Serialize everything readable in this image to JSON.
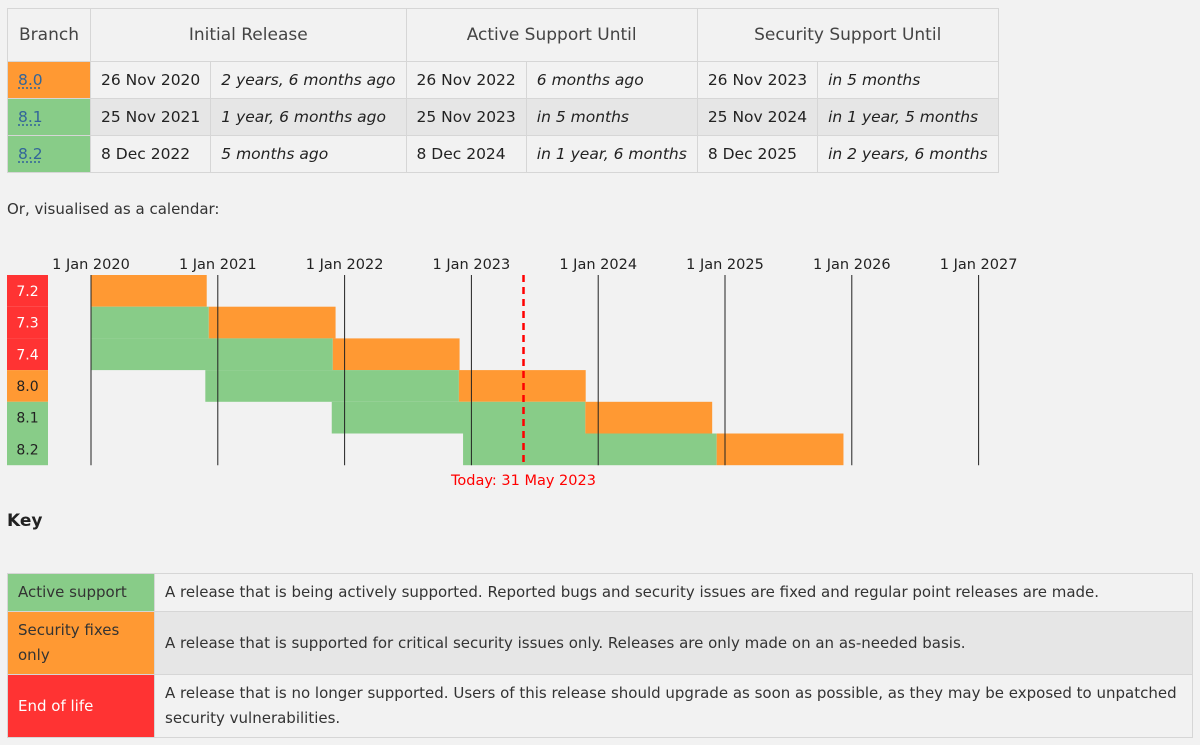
{
  "colors": {
    "active": "#88cc88",
    "security": "#ff9933",
    "eol": "#ff3333",
    "today": "#ff0000",
    "link": "#336699"
  },
  "table": {
    "headers": {
      "branch": "Branch",
      "initial_release": "Initial Release",
      "active_support": "Active Support Until",
      "security_support": "Security Support Until"
    },
    "rows": [
      {
        "branch": "8.0",
        "status": "security",
        "initial": "26 Nov 2020",
        "initial_rel": "2 years, 6 months ago",
        "active": "26 Nov 2022",
        "active_rel": "6 months ago",
        "security": "26 Nov 2023",
        "security_rel": "in 5 months"
      },
      {
        "branch": "8.1",
        "status": "stable",
        "initial": "25 Nov 2021",
        "initial_rel": "1 year, 6 months ago",
        "active": "25 Nov 2023",
        "active_rel": "in 5 months",
        "security": "25 Nov 2024",
        "security_rel": "in 1 year, 5 months"
      },
      {
        "branch": "8.2",
        "status": "stable",
        "initial": "8 Dec 2022",
        "initial_rel": "5 months ago",
        "active": "8 Dec 2024",
        "active_rel": "in 1 year, 6 months",
        "security": "8 Dec 2025",
        "security_rel": "in 2 years, 6 months"
      }
    ]
  },
  "intro_text": "Or, visualised as a calendar:",
  "chart_data": {
    "type": "gantt",
    "title": "",
    "x_ticks": [
      "1 Jan 2020",
      "1 Jan 2021",
      "1 Jan 2022",
      "1 Jan 2023",
      "1 Jan 2024",
      "1 Jan 2025",
      "1 Jan 2026",
      "1 Jan 2027"
    ],
    "x_range": [
      "2020-01-01",
      "2027-01-01"
    ],
    "today": {
      "date": "2023-05-31",
      "label": "Today: 31 May 2023"
    },
    "branches": [
      {
        "name": "7.2",
        "status": "eol",
        "release": "2019-11-28",
        "active_until": "2019-11-28",
        "security_until": "2020-11-30"
      },
      {
        "name": "7.3",
        "status": "eol",
        "release": "2019-11-28",
        "active_until": "2020-12-06",
        "security_until": "2021-12-06"
      },
      {
        "name": "7.4",
        "status": "eol",
        "release": "2019-11-28",
        "active_until": "2021-11-28",
        "security_until": "2022-11-28"
      },
      {
        "name": "8.0",
        "status": "security",
        "release": "2020-11-26",
        "active_until": "2022-11-26",
        "security_until": "2023-11-26"
      },
      {
        "name": "8.1",
        "status": "stable",
        "release": "2021-11-25",
        "active_until": "2023-11-25",
        "security_until": "2024-11-25"
      },
      {
        "name": "8.2",
        "status": "stable",
        "release": "2022-12-08",
        "active_until": "2024-12-08",
        "security_until": "2025-12-08"
      }
    ]
  },
  "key": {
    "title": "Key",
    "items": [
      {
        "status": "stable",
        "label": "Active support",
        "description": "A release that is being actively supported. Reported bugs and security issues are fixed and regular point releases are made."
      },
      {
        "status": "security",
        "label": "Security fixes only",
        "description": "A release that is supported for critical security issues only. Releases are only made on an as-needed basis."
      },
      {
        "status": "eol",
        "label": "End of life",
        "description": "A release that is no longer supported. Users of this release should upgrade as soon as possible, as they may be exposed to unpatched security vulnerabilities."
      }
    ]
  }
}
